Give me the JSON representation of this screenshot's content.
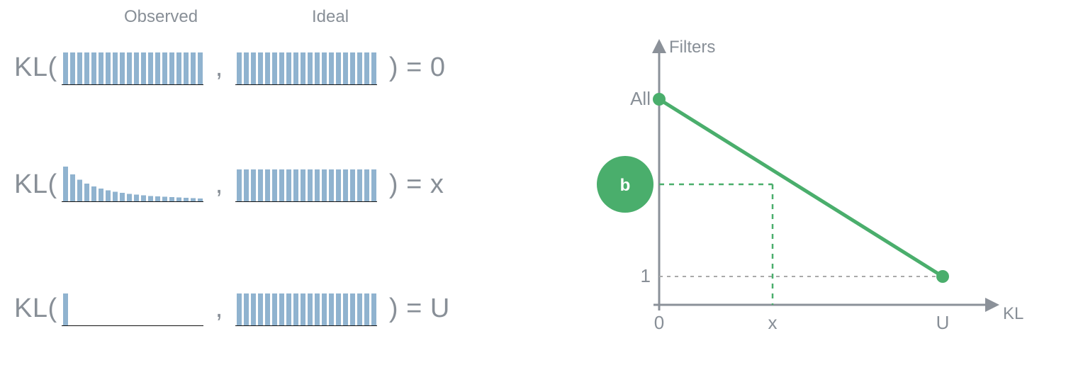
{
  "left": {
    "observed_label": "Observed",
    "ideal_label": "Ideal",
    "kl_prefix": "KL(",
    "comma": " , ",
    "close_eq": " ) = ",
    "results": [
      "0",
      "x",
      "U"
    ]
  },
  "right": {
    "y_title": "Filters",
    "x_title": "KL",
    "y_ticks": [
      "All",
      "1"
    ],
    "x_ticks": [
      "0",
      "x",
      "U"
    ],
    "badge": "b"
  },
  "chart_data": [
    {
      "type": "bar",
      "title": "Observed (uniform)",
      "note": "row 1 observed histogram — visually uniform, KL=0 vs uniform ideal",
      "categories_count": 20,
      "values": [
        1,
        1,
        1,
        1,
        1,
        1,
        1,
        1,
        1,
        1,
        1,
        1,
        1,
        1,
        1,
        1,
        1,
        1,
        1,
        1
      ],
      "xlabel": "",
      "ylabel": ""
    },
    {
      "type": "bar",
      "title": "Ideal (uniform)",
      "note": "uniform reference distribution, identical across all three rows",
      "categories_count": 20,
      "values": [
        1,
        1,
        1,
        1,
        1,
        1,
        1,
        1,
        1,
        1,
        1,
        1,
        1,
        1,
        1,
        1,
        1,
        1,
        1,
        1
      ],
      "xlabel": "",
      "ylabel": ""
    },
    {
      "type": "bar",
      "title": "Observed (decaying)",
      "note": "row 2 observed histogram — monotone decreasing, intermediate KL=x",
      "categories_count": 20,
      "values": [
        1.0,
        0.78,
        0.63,
        0.52,
        0.44,
        0.38,
        0.33,
        0.29,
        0.26,
        0.23,
        0.21,
        0.19,
        0.17,
        0.16,
        0.15,
        0.14,
        0.13,
        0.12,
        0.11,
        0.1
      ],
      "xlabel": "",
      "ylabel": ""
    },
    {
      "type": "bar",
      "title": "Observed (single spike)",
      "note": "row 3 observed histogram — all mass on first bin, KL=U (upper bound)",
      "categories_count": 20,
      "values": [
        1,
        0,
        0,
        0,
        0,
        0,
        0,
        0,
        0,
        0,
        0,
        0,
        0,
        0,
        0,
        0,
        0,
        0,
        0,
        0
      ],
      "xlabel": "",
      "ylabel": ""
    },
    {
      "type": "line",
      "title": "Filters retained vs KL",
      "note": "right-side plot: straight line from (KL=0, Filters=All) to (KL=U, Filters=1); dashed guides mark point (x, b)",
      "x": [
        "0",
        "x",
        "U"
      ],
      "series": [
        {
          "name": "filters_line",
          "points": [
            {
              "x": "0",
              "y": "All"
            },
            {
              "x": "U",
              "y": "1"
            }
          ]
        }
      ],
      "guides": {
        "x": "x",
        "y": "b"
      },
      "xlabel": "KL",
      "ylabel": "Filters"
    }
  ]
}
